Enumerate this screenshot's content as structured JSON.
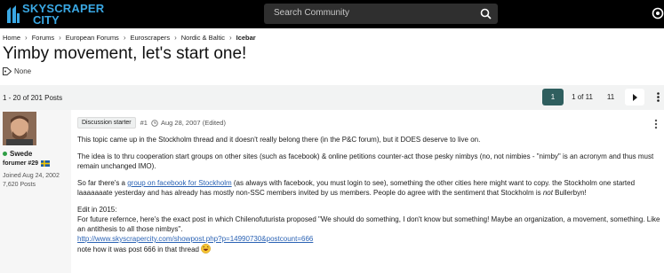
{
  "header": {
    "logo_line1": "SKYSCRAPER",
    "logo_line2": "CITY",
    "search_placeholder": "Search Community",
    "brand_color": "#3aa8e4"
  },
  "breadcrumb": {
    "items": [
      "Home",
      "Forums",
      "European Forums",
      "Euroscrapers",
      "Nordic & Baltic"
    ],
    "current": "Icebar"
  },
  "thread": {
    "title": "Yimby movement, let's start one!",
    "tags_label": "None"
  },
  "pagination": {
    "post_count": "1 - 20 of 201 Posts",
    "current_page": "1",
    "of_label": "1 of 11",
    "last_page": "11",
    "next_icon": "chevron-right-icon",
    "more_icon": "vertical-ellipsis-icon",
    "accent_color": "#2f5f5f"
  },
  "post": {
    "user": {
      "name": "Swede",
      "title": "forumer #29",
      "joined": "Joined Aug 24, 2002",
      "posts": "7,620 Posts",
      "online": true
    },
    "badge": "Discussion starter",
    "number": "#1",
    "date": "Aug 28, 2007 (Edited)",
    "paragraphs": {
      "p1": "This topic came up in the Stockholm thread and it doesn't really belong there (in the P&C forum), but it DOES deserve to live on.",
      "p2": "The idea is to thru cooperation start groups on other sites (such as facebook) & online petitions counter-act those pesky nimbys (no, not nimbies - \"nimby\" is an acronym and thus must remain unchanged IMO).",
      "p3_before": "So far there's a ",
      "p3_link": "group on facebook for Stockholm",
      "p3_after": " (as always with facebook, you must login to see), something the other cities here might want to copy. the Stockholm one started laaaaaaate yesterday and has already has mostly non-SSC members invited by us members. People do agree with the sentiment that Stockholm is ",
      "p3_italic": "not",
      "p3_end": " Bullerbyn!",
      "edit_heading": "Edit in 2015:",
      "edit_text": "For future refernce, here's the exact post in which Chilenofuturista proposed \"We should do something, I don't know but something! Maybe an organization, a movement, something. Like an antithesis to all those nimbys\".",
      "edit_link": "http://www.skyscrapercity.com/showpost.php?p=14990730&postcount=666",
      "last_line": "note how it was post 666 in that thread"
    }
  }
}
